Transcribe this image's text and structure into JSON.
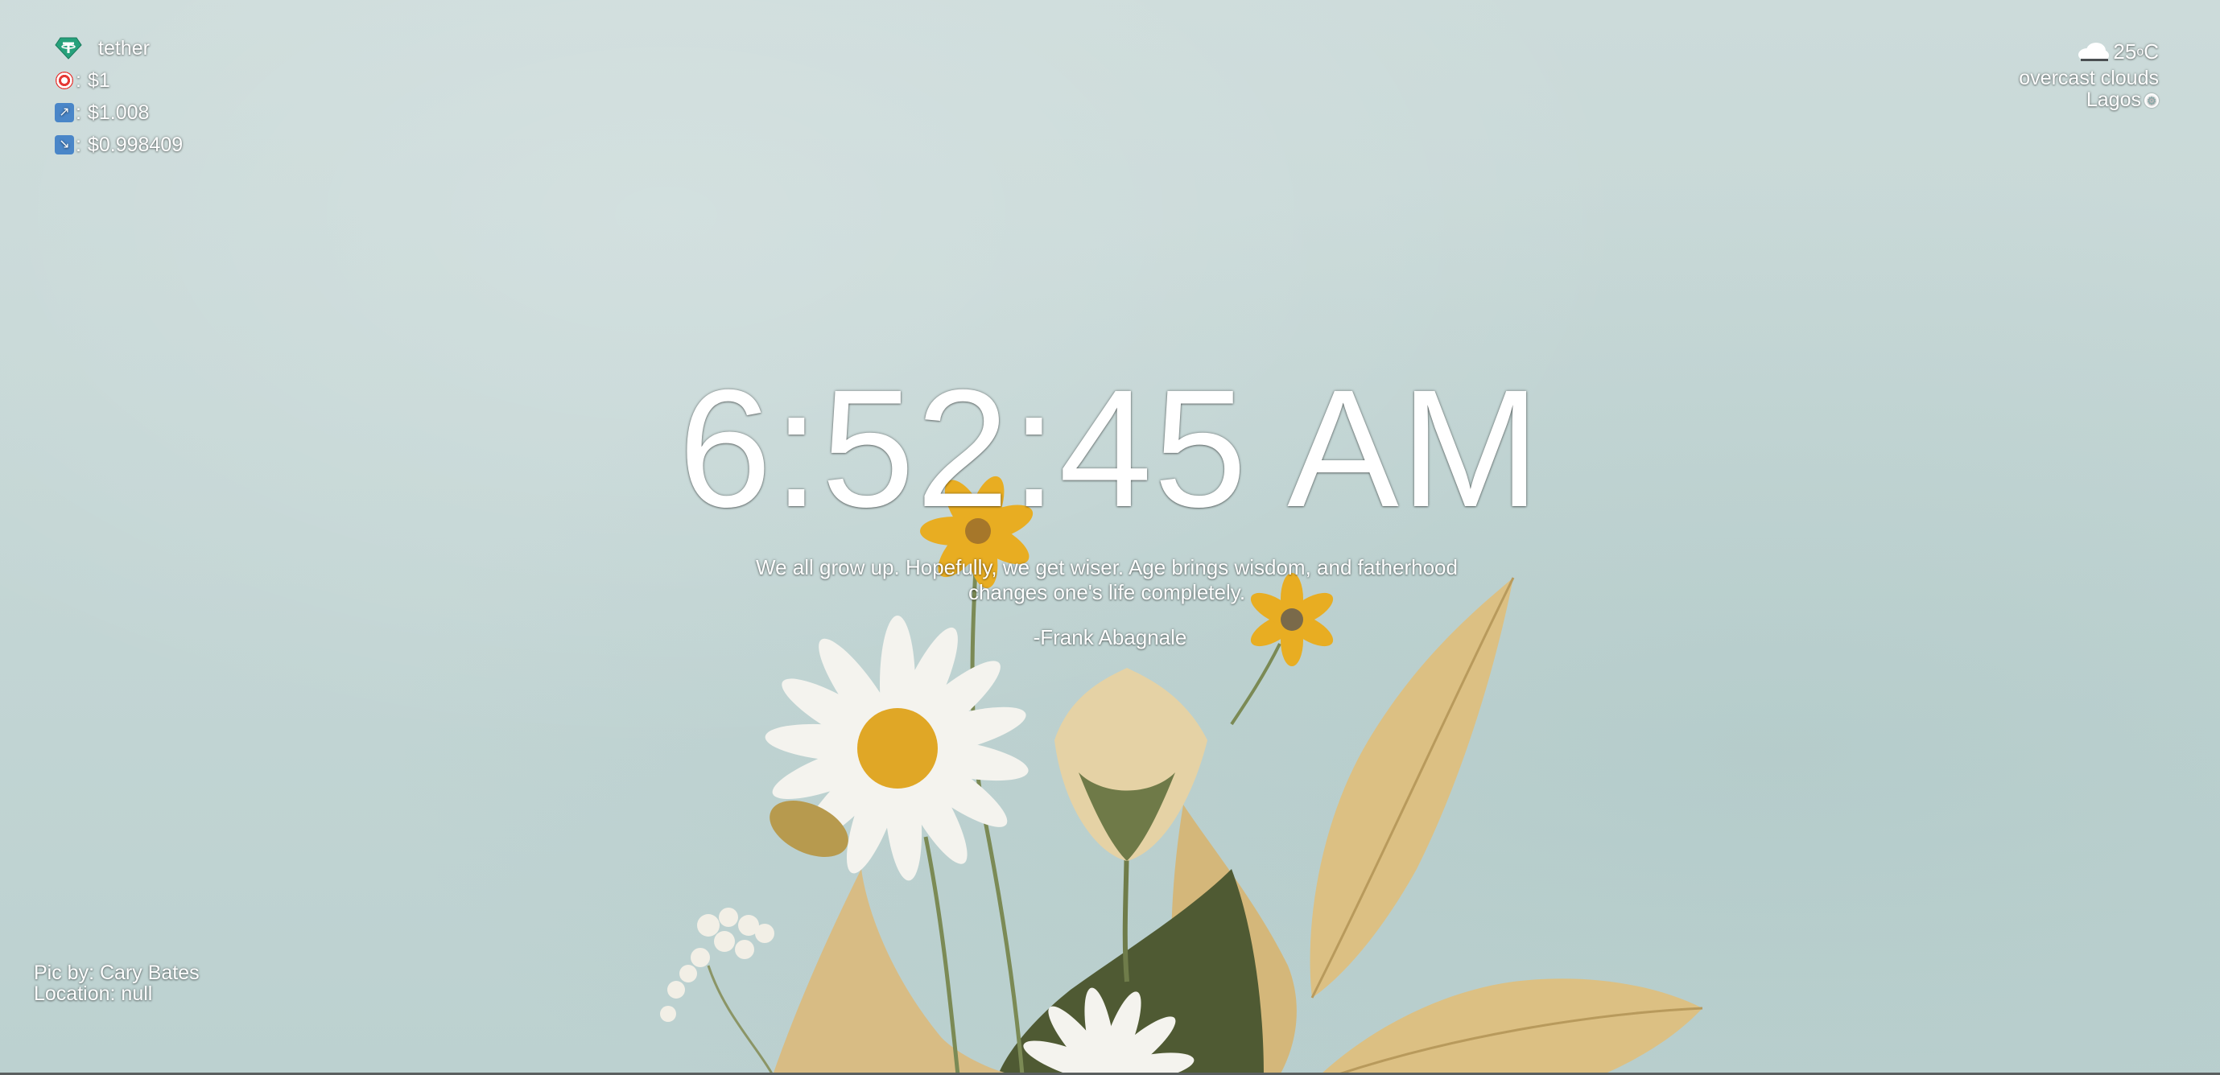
{
  "crypto": {
    "coin_name": "tether",
    "coin_icon": "tether-gem-icon",
    "rows": [
      {
        "icon": "target-icon",
        "value": "$1"
      },
      {
        "icon": "trend-up-icon",
        "value": "$1.008"
      },
      {
        "icon": "trend-down-icon",
        "value": "$0.998409"
      }
    ],
    "separator": ":"
  },
  "weather": {
    "icon": "cloud-icon",
    "temperature": "25",
    "degree": "o",
    "unit": "C",
    "condition": "overcast clouds",
    "city": "Lagos",
    "settings_icon": "gear-icon"
  },
  "clock": {
    "time": "6:52:45 AM"
  },
  "quote": {
    "text": "We all grow up. Hopefully, we get wiser. Age brings wisdom, and fatherhood changes one's life completely.",
    "author": "-Frank Abagnale"
  },
  "credits": {
    "photographer": "Pic by: Cary Bates",
    "location": "Location: null"
  },
  "colors": {
    "background": "#c9d9d7",
    "text": "#ffffff",
    "tether_green": "#26a17b"
  }
}
